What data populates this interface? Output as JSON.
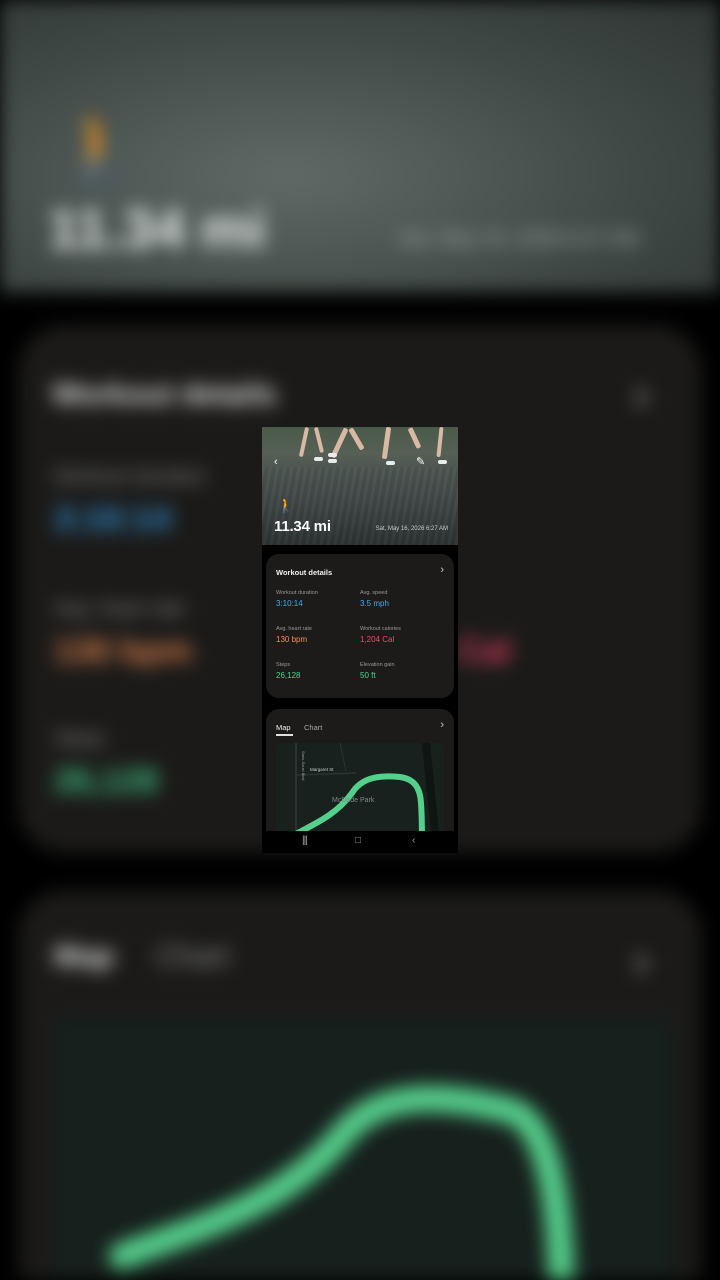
{
  "workout": {
    "activity_icon": "walk-icon",
    "distance": "11.34 mi",
    "datetime": "Sat, May 16, 2026 6:27 AM"
  },
  "header_icons": [
    "back-icon",
    "edit-icon"
  ],
  "details_card": {
    "title": "Workout details",
    "metrics": [
      {
        "label": "Workout duration",
        "value": "3:10:14",
        "color": "#4aa9e8"
      },
      {
        "label": "Avg. speed",
        "value": "3.5 mph",
        "color": "#4aa9e8"
      },
      {
        "label": "Avg. heart rate",
        "value": "130 bpm",
        "color": "#f0935a"
      },
      {
        "label": "Workout calories",
        "value": "1,204 Cal",
        "color": "#ee4a68"
      },
      {
        "label": "Steps",
        "value": "26,128",
        "color": "#4fd58c"
      },
      {
        "label": "Elevation gain",
        "value": "50 ft",
        "color": "#4fd58c"
      }
    ]
  },
  "map_card": {
    "tabs": [
      "Map",
      "Chart"
    ],
    "selected_tab": "Map",
    "street_vertical": "Sans-Souci Blvd",
    "street_horizontal": "Margaret St",
    "park": "McDade Park",
    "route_color": "#55d08c"
  },
  "nav": {
    "items": [
      "recent-apps-icon",
      "home-icon",
      "back-nav-icon"
    ]
  },
  "background": {
    "partial_labels": [
      "Workout duration",
      "Avg. heart rate",
      "Steps",
      "Map",
      "Chart"
    ]
  }
}
